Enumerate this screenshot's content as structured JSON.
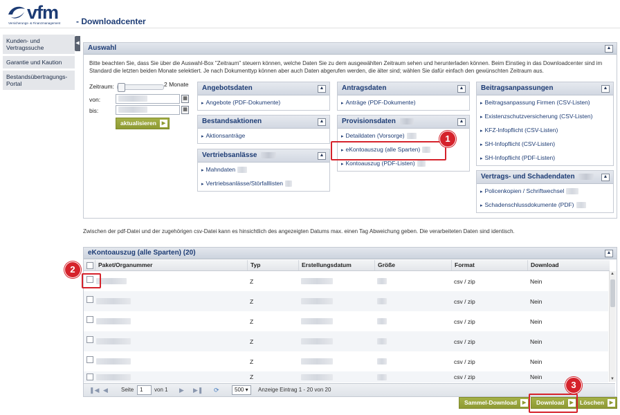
{
  "header": {
    "logo_text": "vfm",
    "logo_tagline": "Versicherungs- & Finanzmanagement",
    "page_title": "- Downloadcenter"
  },
  "sidebar": {
    "items": [
      {
        "label": "Kunden- und Vertragssuche"
      },
      {
        "label": "Garantie und Kaution"
      },
      {
        "label": "Bestandsübertragungs-Portal"
      }
    ]
  },
  "auswahl": {
    "title": "Auswahl",
    "description": "Bitte beachten Sie, dass Sie über die Auswahl-Box \"Zeitraum\" steuern können, welche Daten Sie zu dem ausgewählten Zeitraum sehen und herunterladen können. Beim Einstieg in das Downloadcenter sind im Standard die letzten beiden Monate selektiert. Je nach Dokumenttyp können aber auch Daten abgerufen werden, die älter sind; wählen Sie dafür einfach den gewünschten Zeitraum aus.",
    "zeitraum_label": "Zeitraum:",
    "zeitraum_value": "2 Monate",
    "von_label": "von:",
    "bis_label": "bis:",
    "aktualisieren_label": "aktualisieren",
    "categories": {
      "angebotsdaten": {
        "title": "Angebotsdaten",
        "links": [
          "Angebote (PDF-Dokumente)"
        ]
      },
      "bestandsaktionen": {
        "title": "Bestandsaktionen",
        "links": [
          "Aktionsanträge"
        ]
      },
      "vertriebsanlaesse": {
        "title": "Vertriebsanlässe",
        "links": [
          "Mahndaten",
          "Vertriebsanlässe/Störfalllisten"
        ]
      },
      "antragsdaten": {
        "title": "Antragsdaten",
        "links": [
          "Anträge (PDF-Dokumente)"
        ]
      },
      "provisionsdaten": {
        "title": "Provisionsdaten",
        "links": [
          "Detaildaten (Vorsorge)",
          "eKontoauszug (alle Sparten)",
          "Kontoauszug (PDF-Listen)"
        ]
      },
      "beitragsanpassungen": {
        "title": "Beitragsanpassungen",
        "links": [
          "Beitragsanpassung Firmen (CSV-Listen)",
          "Existenzschutzversicherung (CSV-Listen)",
          "KFZ-Infopflicht (CSV-Listen)",
          "SH-Infopflicht (CSV-Listen)",
          "SH-Infopflicht (PDF-Listen)"
        ]
      },
      "vertrags_schaden": {
        "title": "Vertrags- und Schadendaten",
        "links": [
          "Policenkopien / Schriftwechsel",
          "Schadenschlussdokumente (PDF)"
        ]
      }
    }
  },
  "note": "Zwischen der pdf-Datei und der zugehörigen csv-Datei kann es hinsichtlich des angezeigten Datums max. einen Tag Abweichung geben. Die verarbeiteten Daten sind identisch.",
  "table": {
    "title": "eKontoauszug (alle Sparten) (20)",
    "columns": [
      "Paket/Organummer",
      "Typ",
      "Erstellungsdatum",
      "Größe",
      "Format",
      "Download"
    ],
    "rows": [
      {
        "typ": "Z",
        "format": "csv / zip",
        "download": "Nein"
      },
      {
        "typ": "Z",
        "format": "csv / zip",
        "download": "Nein"
      },
      {
        "typ": "Z",
        "format": "csv / zip",
        "download": "Nein"
      },
      {
        "typ": "Z",
        "format": "csv / zip",
        "download": "Nein"
      },
      {
        "typ": "Z",
        "format": "csv / zip",
        "download": "Nein"
      },
      {
        "typ": "Z",
        "format": "csv / zip",
        "download": "Nein"
      }
    ],
    "pager": {
      "seite_label": "Seite",
      "page": "1",
      "von_label": "von 1",
      "page_size": "500",
      "summary": "Anzeige Eintrag 1 - 20 von 20"
    }
  },
  "actions": {
    "sammel_download": "Sammel-Download",
    "download": "Download",
    "loeschen": "Löschen"
  },
  "annotations": [
    "1",
    "2",
    "3"
  ],
  "colors": {
    "accent": "#8e9a33",
    "brand": "#1c3b74",
    "annotation": "#d5222b"
  }
}
